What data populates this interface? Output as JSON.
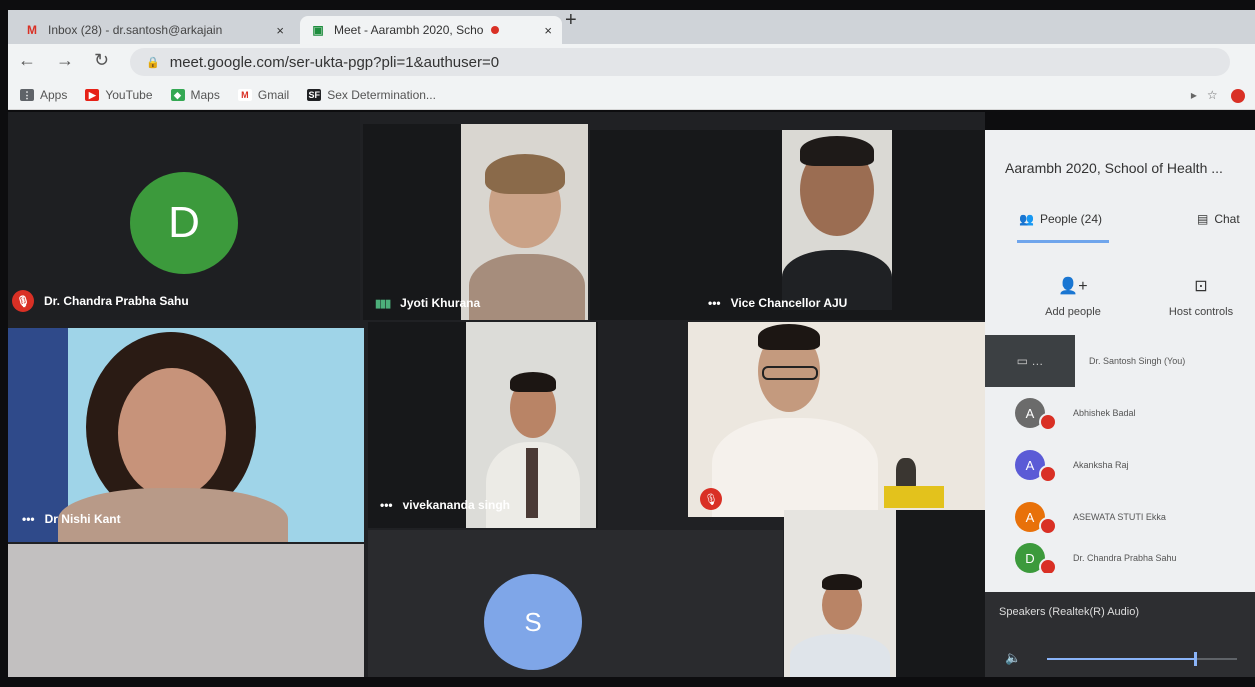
{
  "browser": {
    "tabs": [
      {
        "icon": "gmail-icon",
        "label": "Inbox (28) - dr.santosh@arkajain",
        "close": "×"
      },
      {
        "icon": "meet-icon",
        "label": "Meet - Aarambh 2020, Scho",
        "close": "×"
      }
    ],
    "new_tab": "+",
    "url": "meet.google.com/ser-ukta-pgp?pli=1&authuser=0",
    "bookmarks": [
      {
        "label": "Apps",
        "color": "#5f6368"
      },
      {
        "label": "YouTube",
        "color": "#e62117"
      },
      {
        "label": "Maps",
        "color": "#34a853"
      },
      {
        "label": "Gmail",
        "color": "#d93025"
      },
      {
        "label": "Sex Determination...",
        "color": "#202124"
      }
    ]
  },
  "tiles": {
    "t1": {
      "name": "Dr. Chandra Prabha Sahu",
      "avatar_letter": "D",
      "avatar_color": "#3c9a3c"
    },
    "t2": {
      "name": "Jyoti Khurana"
    },
    "t3": {
      "name": "Vice Chancellor AJU"
    },
    "t4": {
      "name": "Dr Nishi Kant"
    },
    "t5": {
      "name": "vivekananda singh"
    },
    "t7": {
      "avatar_letter": "S",
      "avatar_color": "#7fa6e8"
    }
  },
  "panel": {
    "title": "Aarambh 2020, School of Health ...",
    "people_tab": "People (24)",
    "chat_tab": "Chat",
    "add_people": "Add people",
    "host_controls": "Host controls",
    "participants": [
      {
        "name": "Dr. Santosh Singh (You)",
        "self": true
      },
      {
        "name": "Abhishek Badal",
        "letter": "A",
        "color": "#6b6b6b"
      },
      {
        "name": "Akanksha Raj",
        "letter": "A",
        "color": "#5b5bd6"
      },
      {
        "name": "ASEWATA STUTI Ekka",
        "letter": "A",
        "color": "#e8710a"
      },
      {
        "name": "Dr. Chandra Prabha Sahu",
        "letter": "D",
        "color": "#3c9a3c"
      }
    ]
  },
  "audio": {
    "label": "Speakers (Realtek(R) Audio)",
    "volume_fraction": 0.78
  }
}
